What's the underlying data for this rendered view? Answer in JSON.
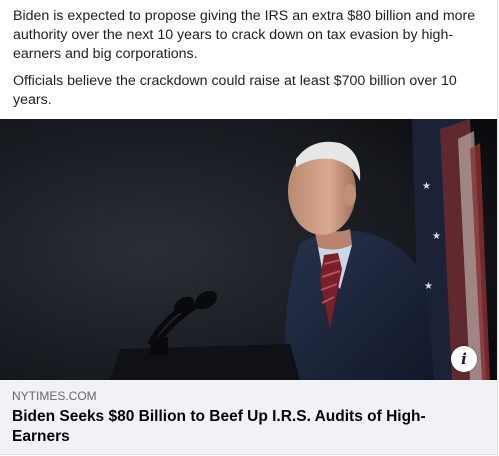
{
  "post": {
    "paragraphs": [
      "Biden is expected to propose giving the IRS an extra $80 billion and more authority over the next 10 years to crack down on tax evasion by high-earners and big corporations.",
      "Officials believe the crackdown could raise at least $700 billion over 10 years."
    ]
  },
  "media": {
    "description_icon": "info-icon",
    "info_glyph": "i"
  },
  "link_card": {
    "domain": "NYTIMES.COM",
    "title": "Biden Seeks $80 Billion to Beef Up I.R.S. Audits of High-Earners"
  },
  "colors": {
    "text": "#1c1e21",
    "card_background": "#f0f2f5",
    "domain_text": "#65676b",
    "photo_background": "#161a20"
  }
}
